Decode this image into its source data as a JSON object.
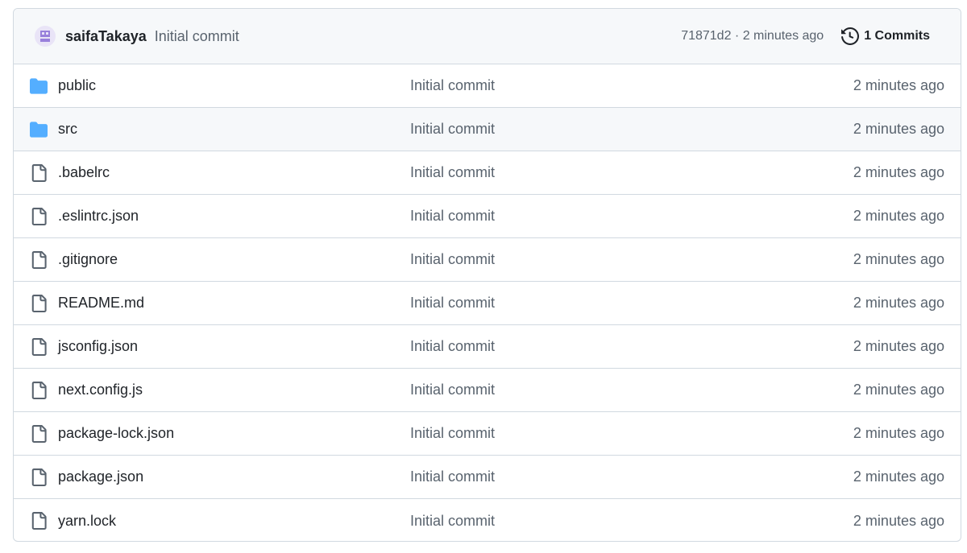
{
  "latest_commit": {
    "author": "saifaTakaya",
    "message": "Initial commit",
    "meta": "71871d2 · 2 minutes ago",
    "commits_label": "1 Commits"
  },
  "colors": {
    "folder": "#54aeff",
    "file_icon": "#59636e",
    "avatar_accent": "#8a6fd6"
  },
  "files": [
    {
      "type": "folder",
      "icon": "folder-icon",
      "name": "public",
      "message": "Initial commit",
      "time": "2 minutes ago"
    },
    {
      "type": "folder",
      "icon": "folder-icon",
      "name": "src",
      "message": "Initial commit",
      "time": "2 minutes ago"
    },
    {
      "type": "file",
      "icon": "file-icon",
      "name": ".babelrc",
      "message": "Initial commit",
      "time": "2 minutes ago"
    },
    {
      "type": "file",
      "icon": "file-icon",
      "name": ".eslintrc.json",
      "message": "Initial commit",
      "time": "2 minutes ago"
    },
    {
      "type": "file",
      "icon": "file-icon",
      "name": ".gitignore",
      "message": "Initial commit",
      "time": "2 minutes ago"
    },
    {
      "type": "file",
      "icon": "file-icon",
      "name": "README.md",
      "message": "Initial commit",
      "time": "2 minutes ago"
    },
    {
      "type": "file",
      "icon": "file-icon",
      "name": "jsconfig.json",
      "message": "Initial commit",
      "time": "2 minutes ago"
    },
    {
      "type": "file",
      "icon": "file-icon",
      "name": "next.config.js",
      "message": "Initial commit",
      "time": "2 minutes ago"
    },
    {
      "type": "file",
      "icon": "file-icon",
      "name": "package-lock.json",
      "message": "Initial commit",
      "time": "2 minutes ago"
    },
    {
      "type": "file",
      "icon": "file-icon",
      "name": "package.json",
      "message": "Initial commit",
      "time": "2 minutes ago"
    },
    {
      "type": "file",
      "icon": "file-icon",
      "name": "yarn.lock",
      "message": "Initial commit",
      "time": "2 minutes ago"
    }
  ]
}
